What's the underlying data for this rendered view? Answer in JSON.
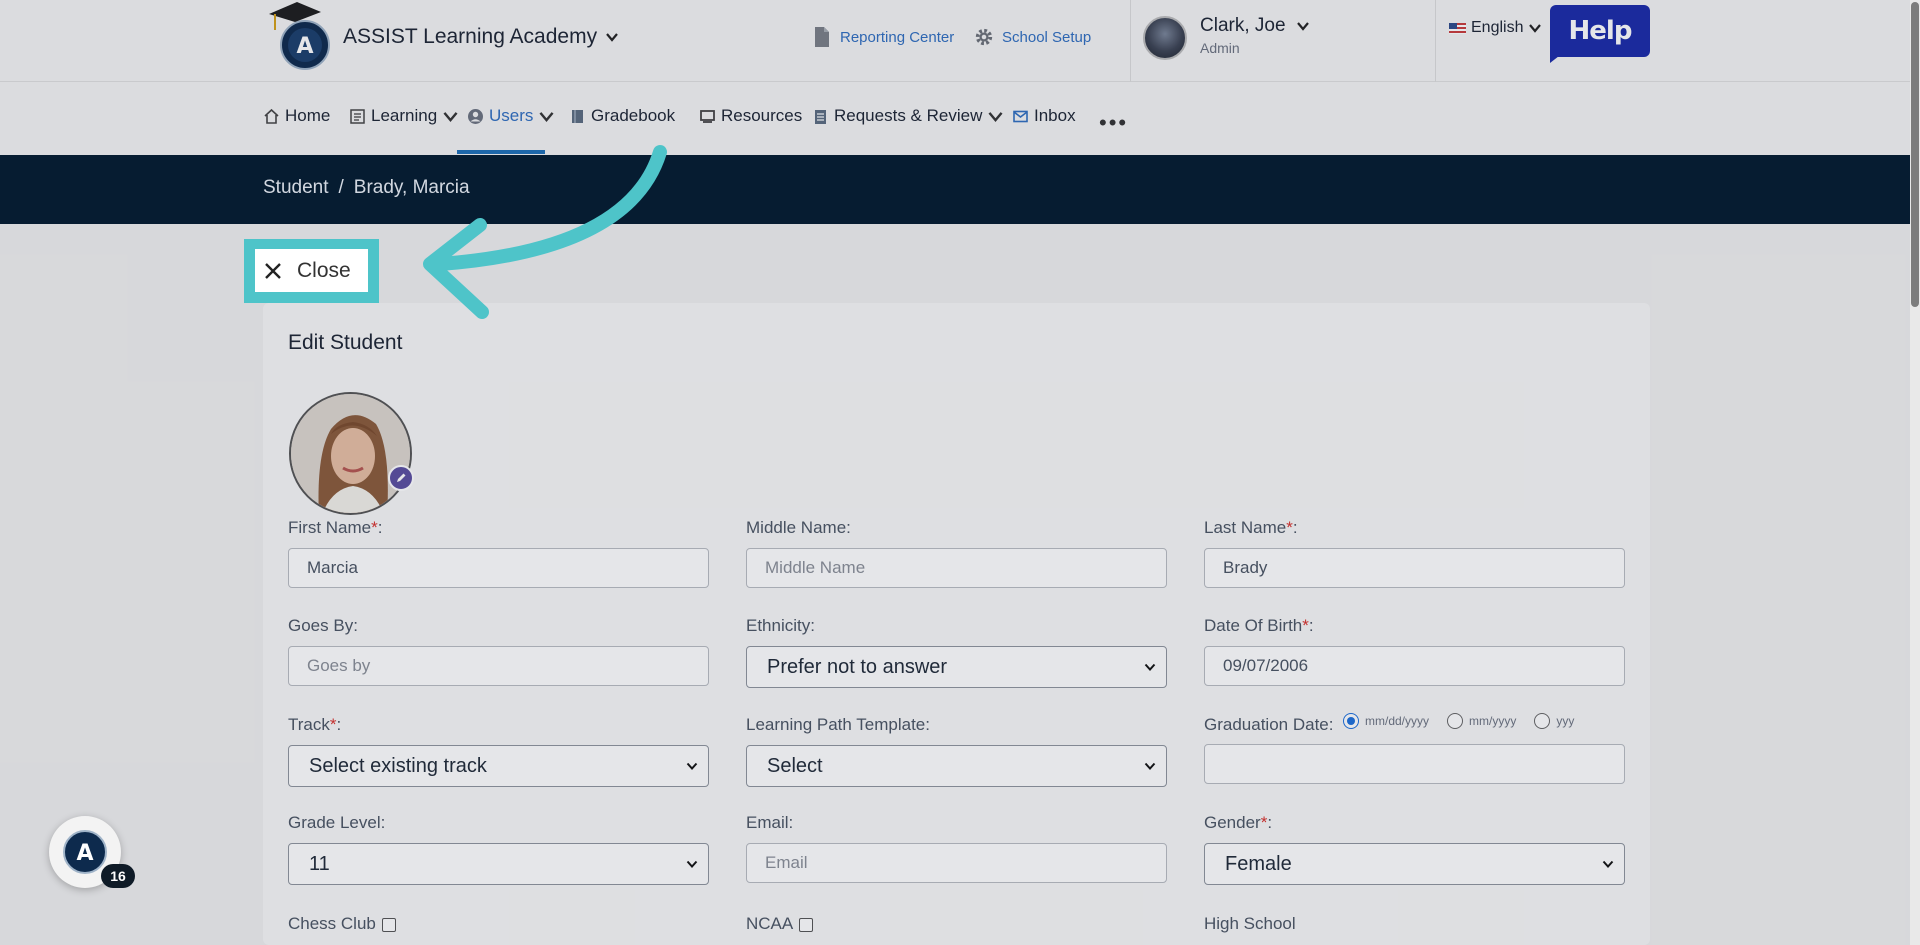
{
  "header": {
    "school_name": "ASSIST Learning Academy",
    "reporting_center": "Reporting Center",
    "school_setup": "School Setup",
    "user_name": "Clark, Joe",
    "user_role": "Admin",
    "language": "English",
    "help_label": "Help"
  },
  "nav": {
    "items": [
      {
        "label": "Home",
        "icon": "home-icon"
      },
      {
        "label": "Learning",
        "icon": "learning-icon"
      },
      {
        "label": "Users",
        "icon": "user-circle-icon"
      },
      {
        "label": "Gradebook",
        "icon": "book-icon"
      },
      {
        "label": "Resources",
        "icon": "monitor-icon"
      },
      {
        "label": "Requests & Review",
        "icon": "clipboard-icon"
      },
      {
        "label": "Inbox",
        "icon": "mail-icon"
      }
    ],
    "more": "•••"
  },
  "breadcrumb": {
    "parent": "Student",
    "separator": "/",
    "current": "Brady, Marcia"
  },
  "close_label": "Close",
  "form": {
    "title": "Edit Student",
    "first_name": {
      "label": "First Name",
      "value": "Marcia",
      "required": "*"
    },
    "middle_name": {
      "label": "Middle Name:",
      "placeholder": "Middle Name"
    },
    "last_name": {
      "label": "Last Name",
      "value": "Brady",
      "required": "*"
    },
    "goes_by": {
      "label": "Goes By:",
      "placeholder": "Goes by"
    },
    "ethnicity": {
      "label": "Ethnicity:",
      "value": "Prefer not to answer"
    },
    "dob": {
      "label": "Date Of Birth",
      "value": "09/07/2006",
      "required": "*"
    },
    "track": {
      "label": "Track",
      "value": "Select existing track",
      "required": "*"
    },
    "learning_path": {
      "label": "Learning Path Template:",
      "value": "Select"
    },
    "graduation": {
      "label": "Graduation Date:",
      "options": [
        "mm/dd/yyyy",
        "mm/yyyy",
        "yyy"
      ],
      "value": ""
    },
    "grade_level": {
      "label": "Grade Level:",
      "value": "11"
    },
    "email": {
      "label": "Email:",
      "placeholder": "Email"
    },
    "gender": {
      "label": "Gender",
      "value": "Female",
      "required": "*"
    },
    "chess_club": {
      "label": "Chess Club"
    },
    "ncaa": {
      "label": "NCAA"
    },
    "high_school": {
      "label": "High School"
    }
  },
  "fab_count": "16",
  "colors": {
    "accent": "#2f6ec0",
    "crumb_bar": "#021a2e",
    "highlight": "#4ec4c9",
    "help": "#1a2aa8"
  }
}
